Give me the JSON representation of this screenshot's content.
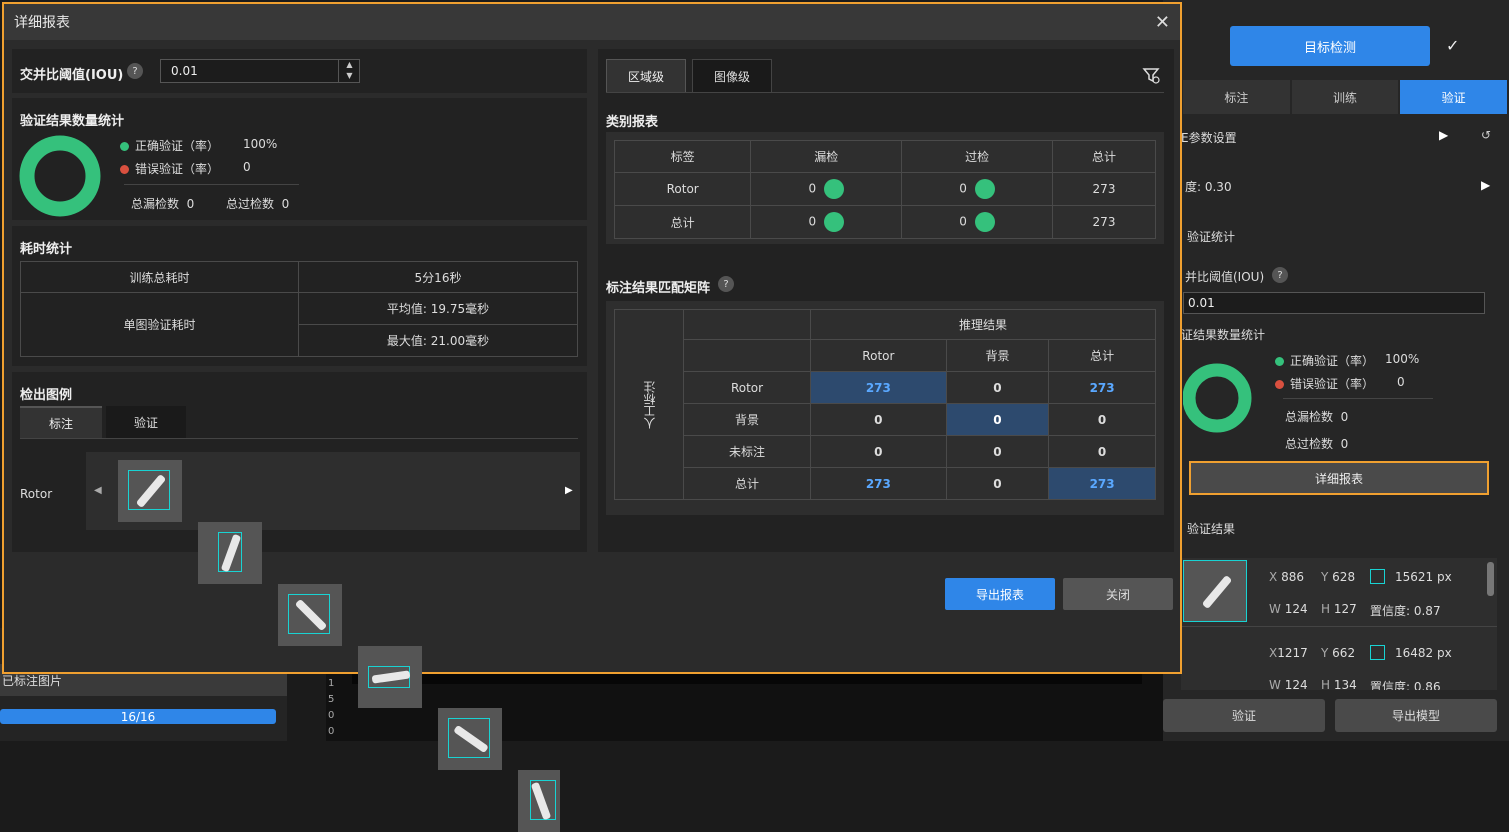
{
  "background": {
    "labeled_images": "已标注图片",
    "progress_text": "16/16",
    "progress": 1.0,
    "ruler_ticks": [
      "1",
      "5",
      "0",
      "0"
    ]
  },
  "right_panel": {
    "mode_button": "目标检测",
    "tabs": [
      "标注",
      "训练",
      "验证"
    ],
    "active_tab": "验证",
    "param_settings": "E参数设置",
    "confidence": "度: 0.30",
    "validation_stats": "验证统计",
    "iou_label": "并比阈值(IOU)",
    "iou_value": "0.01",
    "result_count_stats": "证结果数量统计",
    "correct_label": "正确验证（率）",
    "correct_value": "100%",
    "wrong_label": "错误验证（率）",
    "wrong_value": "0",
    "total_miss_label": "总漏检数",
    "total_miss_value": "0",
    "total_over_label": "总过检数",
    "total_over_value": "0",
    "detail_button": "详细报表",
    "validation_results": "验证结果",
    "results": [
      {
        "x": "886",
        "y": "628",
        "area": "15621 px",
        "w": "124",
        "h": "127",
        "confidence": "置信度: 0.87"
      },
      {
        "x": "1217",
        "y": "662",
        "area": "16482 px",
        "w": "124",
        "h": "134",
        "confidence": "置信度: 0.86"
      }
    ],
    "validate_button": "验证",
    "export_model_button": "导出模型"
  },
  "modal": {
    "title": "详细报表",
    "iou_label": "交并比阈值(IOU)",
    "iou_value": "0.01",
    "result_stats_title": "验证结果数量统计",
    "correct_label": "正确验证（率）",
    "correct_value": "100%",
    "wrong_label": "错误验证（率）",
    "wrong_value": "0",
    "total_miss_label": "总漏检数",
    "total_miss_value": "0",
    "total_over_label": "总过检数",
    "total_over_value": "0",
    "time_title": "耗时统计",
    "train_total_label": "训练总耗时",
    "train_total_value": "5分16秒",
    "single_label": "单图验证耗时",
    "avg_value": "平均值: 19.75毫秒",
    "max_value": "最大值: 21.00毫秒",
    "legend_title": "检出图例",
    "legend_tabs": [
      "标注",
      "验证"
    ],
    "legend_class": "Rotor",
    "tabs": [
      "区域级",
      "图像级"
    ],
    "class_report_title": "类别报表",
    "class_headers": [
      "标签",
      "漏检",
      "过检",
      "总计"
    ],
    "class_rows": [
      {
        "label": "Rotor",
        "miss": "0",
        "over": "0",
        "total": "273"
      },
      {
        "label": "总计",
        "miss": "0",
        "over": "0",
        "total": "273"
      }
    ],
    "matrix_title": "标注结果匹配矩阵",
    "matrix_top": "推理结果",
    "matrix_side": "人工标注",
    "matrix_cols": [
      "Rotor",
      "背景",
      "总计"
    ],
    "matrix_rows": [
      {
        "label": "Rotor",
        "cells": [
          "273",
          "0",
          "273"
        ]
      },
      {
        "label": "背景",
        "cells": [
          "0",
          "0",
          "0"
        ]
      },
      {
        "label": "未标注",
        "cells": [
          "0",
          "0",
          "0"
        ]
      },
      {
        "label": "总计",
        "cells": [
          "273",
          "0",
          "273"
        ]
      }
    ],
    "export_button": "导出报表",
    "close_button": "关闭"
  },
  "colors": {
    "accent": "#2f86e8",
    "green": "#35c17c",
    "red": "#d9503f",
    "highlight": "#f0a030"
  }
}
